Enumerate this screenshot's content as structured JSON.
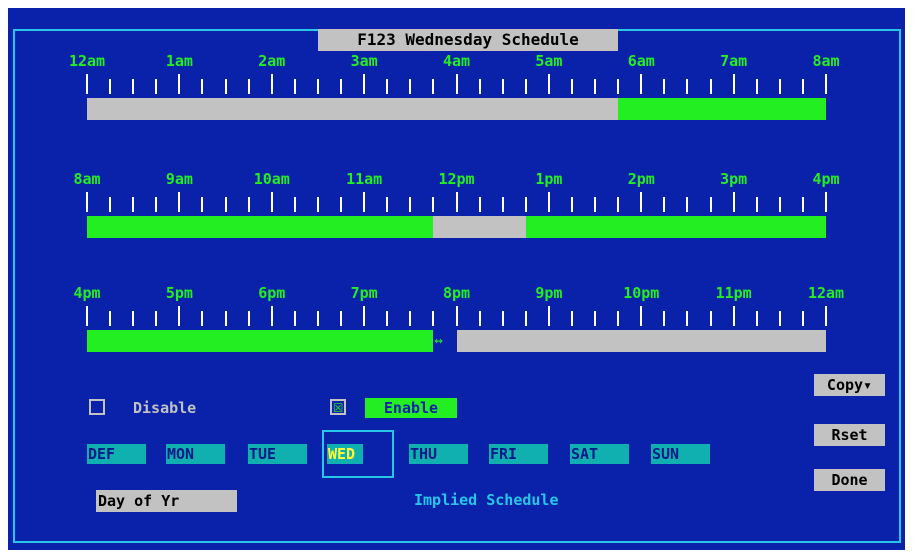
{
  "title": "F123 Wednesday Schedule",
  "timelines": [
    {
      "labels": [
        "12am",
        "1am",
        "2am",
        "3am",
        "4am",
        "5am",
        "6am",
        "7am",
        "8am"
      ],
      "segments": [
        {
          "state": "off",
          "start": 0,
          "end": 5.75
        },
        {
          "state": "on",
          "start": 5.75,
          "end": 8
        }
      ],
      "gap": null
    },
    {
      "labels": [
        "8am",
        "9am",
        "10am",
        "11am",
        "12pm",
        "1pm",
        "2pm",
        "3pm",
        "4pm"
      ],
      "segments": [
        {
          "state": "on",
          "start": 0,
          "end": 3.75
        },
        {
          "state": "off",
          "start": 3.75,
          "end": 4.75
        },
        {
          "state": "on",
          "start": 4.75,
          "end": 8
        }
      ],
      "gap": null
    },
    {
      "labels": [
        "4pm",
        "5pm",
        "6pm",
        "7pm",
        "8pm",
        "9pm",
        "10pm",
        "11pm",
        "12am"
      ],
      "segments": [
        {
          "state": "on",
          "start": 0,
          "end": 3.75
        },
        {
          "state": "off",
          "start": 4.0,
          "end": 8
        }
      ],
      "gap": {
        "glyph": "↔",
        "at": 3.75
      }
    }
  ],
  "options": {
    "disable_label": "Disable",
    "disable_checked": false,
    "enable_label": "Enable",
    "enable_checked": true,
    "check_glyph": "☒"
  },
  "days": [
    {
      "label": "DEF",
      "selected": false
    },
    {
      "label": "MON",
      "selected": false
    },
    {
      "label": "TUE",
      "selected": false
    },
    {
      "label": "WED",
      "selected": true
    },
    {
      "label": "THU",
      "selected": false
    },
    {
      "label": "FRI",
      "selected": false
    },
    {
      "label": "SAT",
      "selected": false
    },
    {
      "label": "SUN",
      "selected": false
    }
  ],
  "buttons": {
    "copy": "Copy▾",
    "reset": "Rset",
    "done": "Done",
    "day_of_year": "Day of Yr"
  },
  "implied_label": "Implied Schedule",
  "colors": {
    "background": "#0a22aa",
    "on": "#22ee22",
    "off": "#c2c2c2",
    "accent": "#27c6e6",
    "selected_text": "#ffff33"
  }
}
